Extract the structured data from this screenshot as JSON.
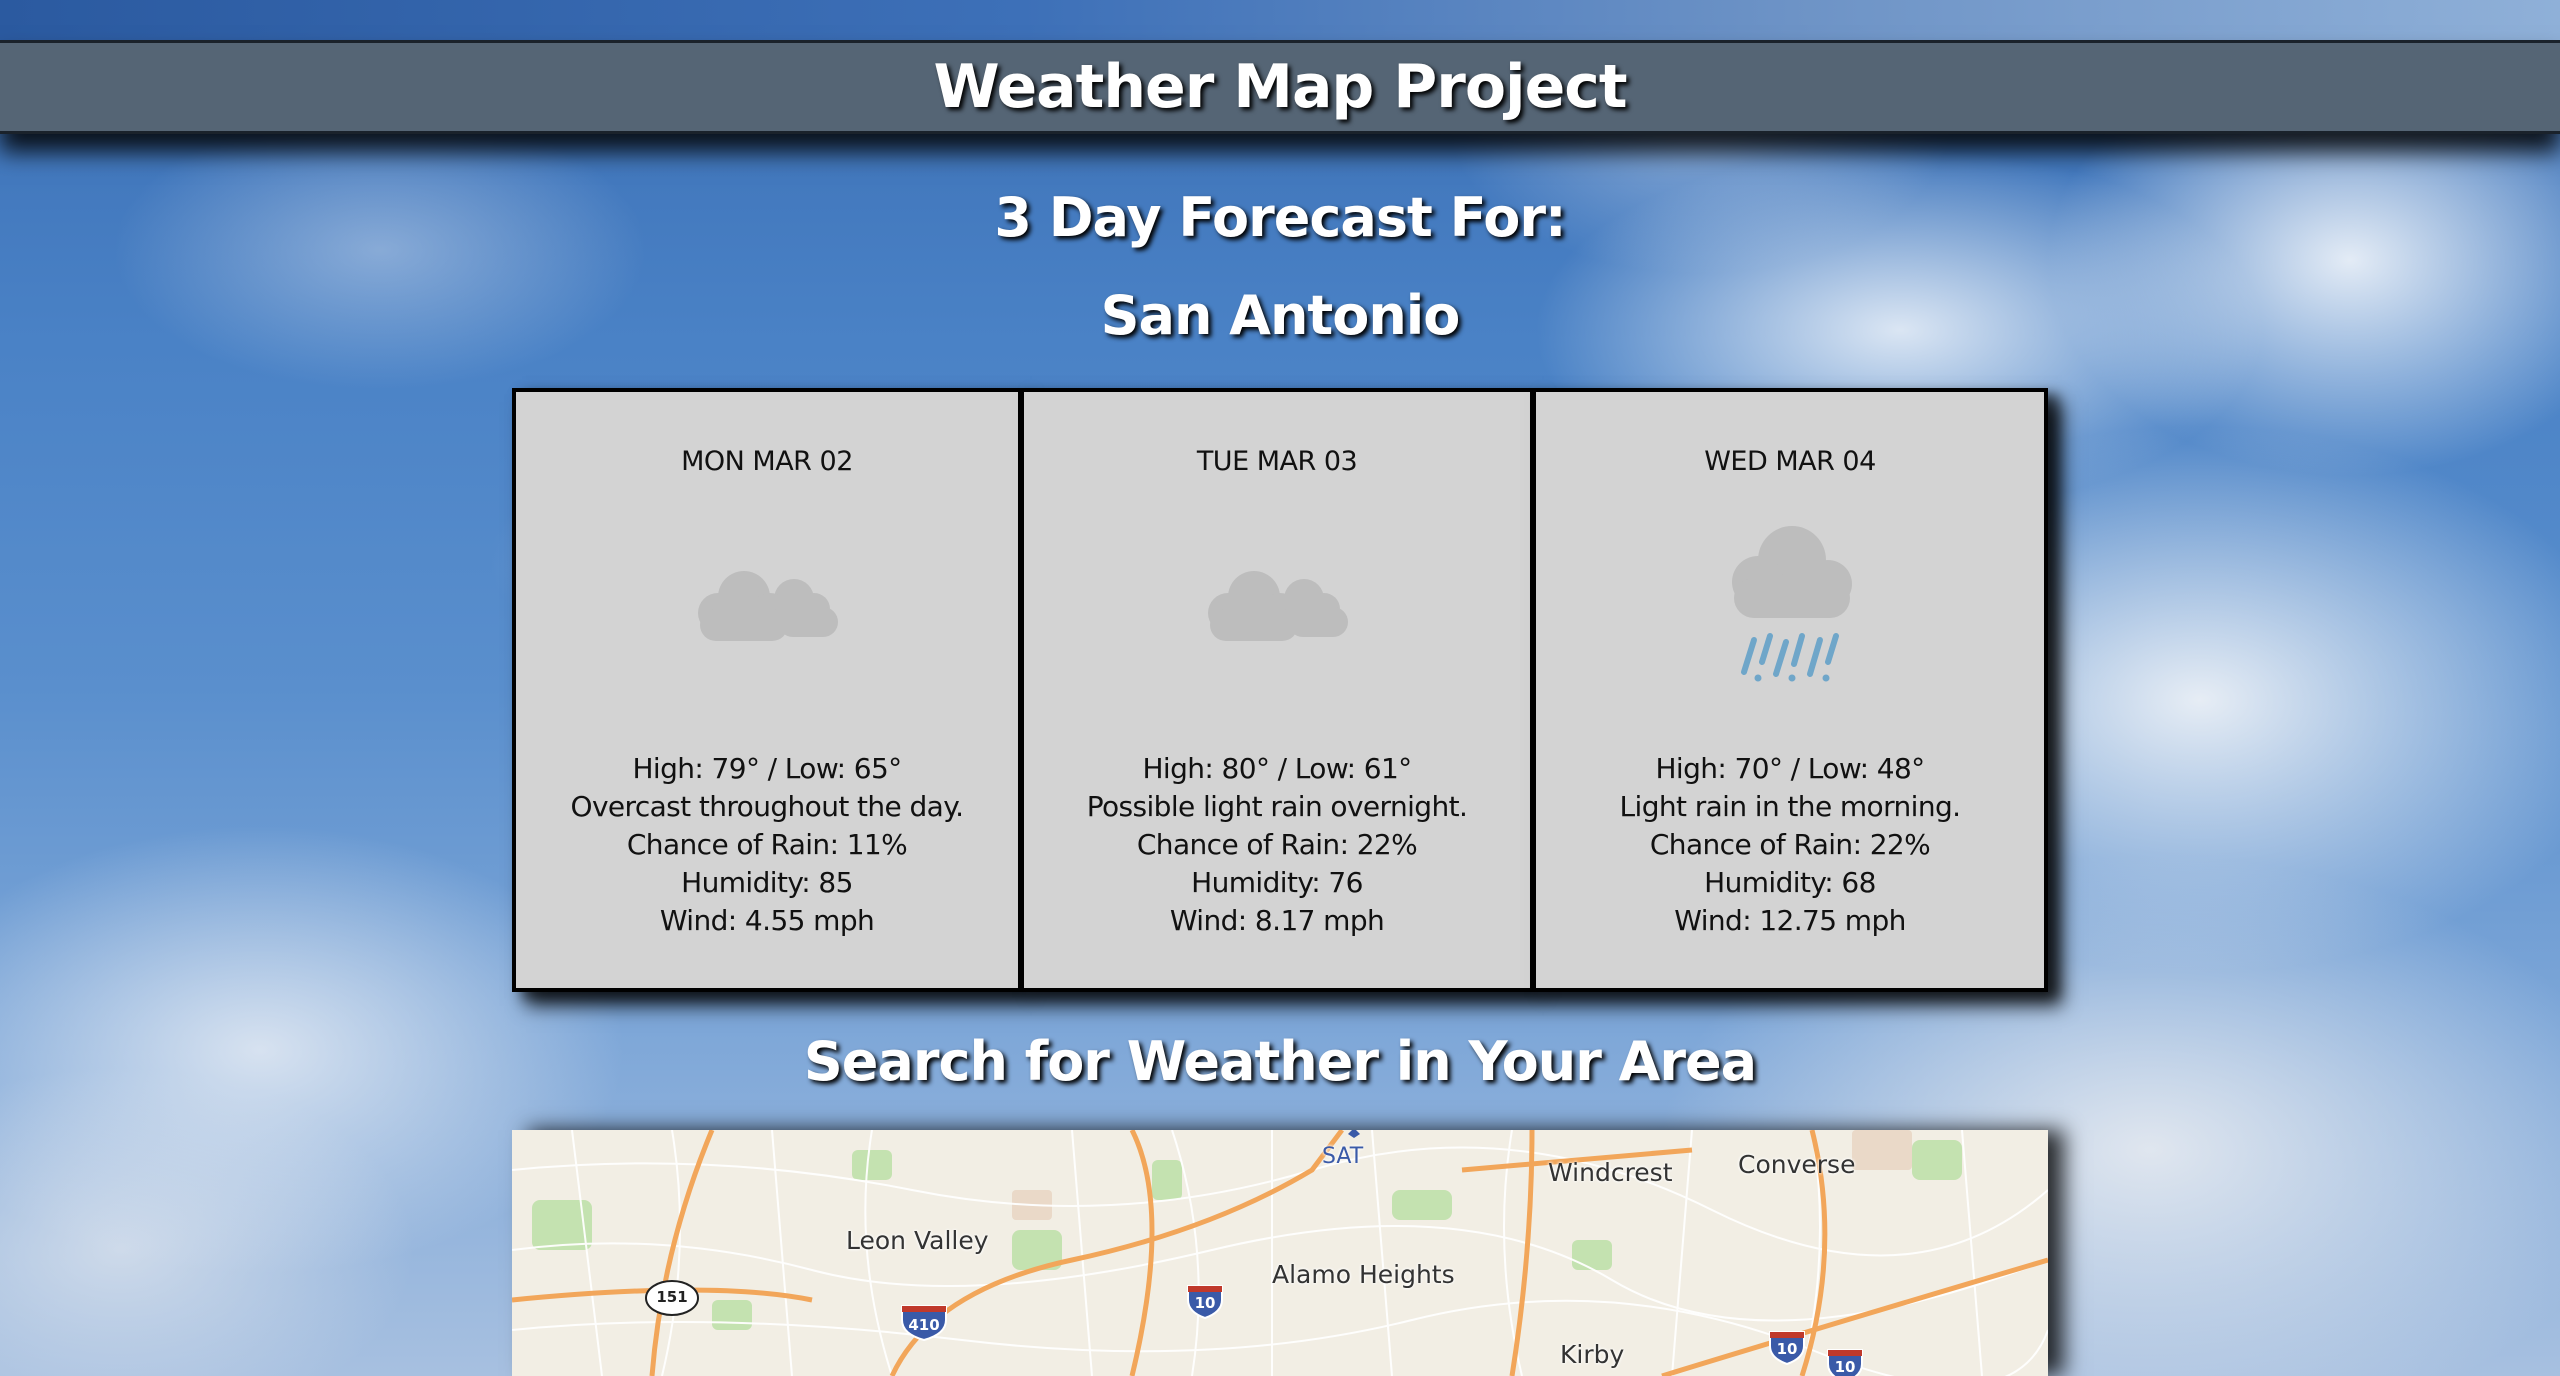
{
  "header": {
    "title": "Weather Map Project"
  },
  "forecast": {
    "heading": "3 Day Forecast For:",
    "city": "San Antonio",
    "days": [
      {
        "date": "MON MAR 02",
        "icon": "partly-cloudy-icon",
        "temps": "High: 79° / Low: 65°",
        "summary": "Overcast throughout the day.",
        "rain": "Chance of Rain: 11%",
        "humidity": "Humidity: 85",
        "wind": "Wind: 4.55 mph"
      },
      {
        "date": "TUE MAR 03",
        "icon": "partly-cloudy-icon",
        "temps": "High: 80° / Low: 61°",
        "summary": "Possible light rain overnight.",
        "rain": "Chance of Rain: 22%",
        "humidity": "Humidity: 76",
        "wind": "Wind: 8.17 mph"
      },
      {
        "date": "WED MAR 04",
        "icon": "rain-cloud-icon",
        "temps": "High: 70° / Low: 48°",
        "summary": "Light rain in the morning.",
        "rain": "Chance of Rain: 22%",
        "humidity": "Humidity: 68",
        "wind": "Wind: 12.75 mph"
      }
    ]
  },
  "search": {
    "heading": "Search for Weather in Your Area"
  },
  "map": {
    "labels": {
      "sat": "SAT",
      "windcrest": "Windcrest",
      "converse": "Converse",
      "leon_valley": "Leon Valley",
      "alamo_heights": "Alamo Heights",
      "kirby": "Kirby"
    },
    "shields": {
      "hwy151": "151",
      "i410": "410",
      "i10_a": "10",
      "i10_b": "10",
      "i10_c": "10"
    }
  },
  "colors": {
    "header_bg": "#556575",
    "card_bg": "#d3d3d3",
    "cloud": "#bdbdbd",
    "rain": "#6fa6c9",
    "map_bg": "#f2eee4",
    "highway": "#f2a65a",
    "interstate": "#3a5aa8"
  }
}
